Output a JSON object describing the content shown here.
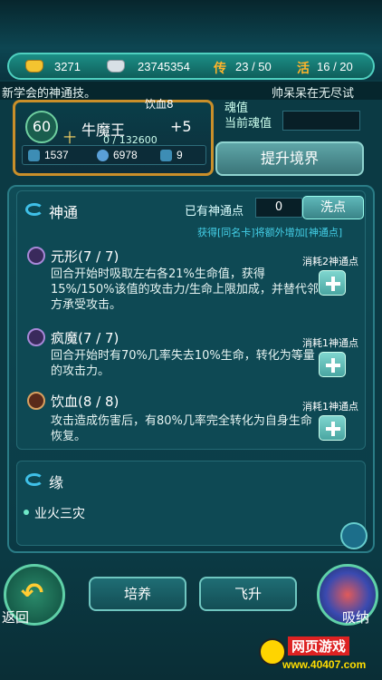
{
  "resources": {
    "gold": "3271",
    "silver": "23745354",
    "chuan_label": "传",
    "chuan_value": "23 / 50",
    "huo_label": "活",
    "huo_value": "16 / 20"
  },
  "marquee": {
    "left_text": "新学会的神通技。",
    "right_text": "帅呆呆在无尽试"
  },
  "hero": {
    "partial_label": "饮血8",
    "level": "60",
    "name": "牛魔王",
    "plus": "+5",
    "exp": "0 / 132600",
    "stats": [
      "1537",
      "6978",
      "9"
    ]
  },
  "soul": {
    "label_top": "魂值",
    "label_current": "当前魂值",
    "upgrade_button": "提升境界"
  },
  "shentong": {
    "title": "神通",
    "points_label": "已有神通点",
    "points_value": "0",
    "wash_button": "洗点",
    "hint": "获得[同名卡]将额外增加[神通点]",
    "skills": [
      {
        "title": "元形(7 / 7)",
        "cost": "消耗2神通点",
        "desc": "回合开始时吸取左右各21%生命值，获得15%/150%该值的攻击力/生命上限加成，并替代邻方承受攻击。"
      },
      {
        "title": "疯魔(7 / 7)",
        "cost": "消耗1神通点",
        "desc": "回合开始时有70%几率失去10%生命，转化为等量的攻击力。"
      },
      {
        "title": "饮血(8 / 8)",
        "cost": "消耗1神通点",
        "desc": "攻击造成伤害后，有80%几率完全转化为自身生命恢复。"
      }
    ]
  },
  "fate": {
    "title": "缘",
    "item": "业火三灾"
  },
  "bottom": {
    "back": "返回",
    "train": "培养",
    "ascend": "飞升",
    "absorb": "吸纳"
  },
  "watermark": {
    "line1": "网页游戏",
    "line2": "www.40407.com"
  },
  "colors": {
    "accent": "#3fc0e8",
    "frame_gold": "#c98f2a",
    "hint_cyan": "#44d0e8"
  }
}
